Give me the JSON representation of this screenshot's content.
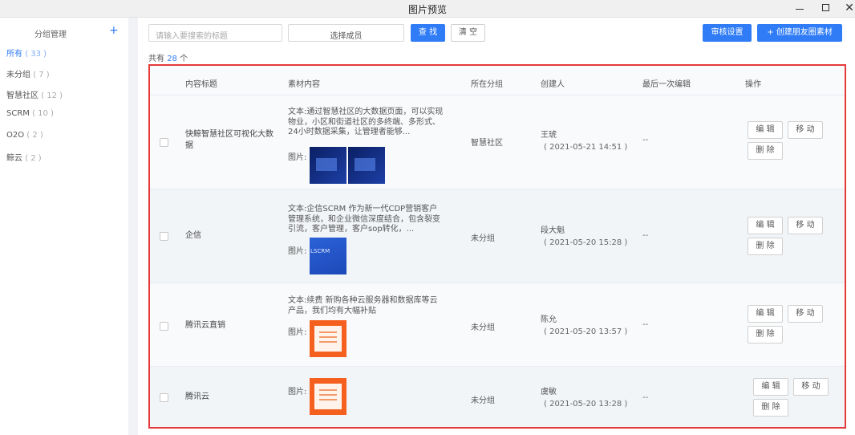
{
  "window": {
    "title": "图片预览"
  },
  "sidebar": {
    "header": "分组管理",
    "add_icon": "+",
    "items": [
      {
        "label": "所有",
        "count": "( 33 )",
        "active": true
      },
      {
        "label": "未分组",
        "count": "( 7 )"
      },
      {
        "label": "智慧社区",
        "count": "( 12 )"
      },
      {
        "label": "SCRM",
        "count": "( 10 )"
      },
      {
        "label": "O2O",
        "count": "( 2 )"
      },
      {
        "label": "鲸云",
        "count": "( 2 )"
      }
    ]
  },
  "toolbar": {
    "search_placeholder": "请输入要搜索的标题",
    "member_select": "选择成员",
    "search_button": "查 找",
    "clear_button": "清 空",
    "review_button": "审核设置",
    "create_button": "+ 创建朋友圈素材"
  },
  "summary": {
    "prefix": "共有",
    "count": "28",
    "suffix": "个"
  },
  "table": {
    "headers": [
      "内容标题",
      "素材内容",
      "所在分组",
      "创建人",
      "最后一次编辑",
      "操作"
    ],
    "text_label": "文本:",
    "image_label": "图片:",
    "actions": {
      "edit": "编 辑",
      "move": "移 动",
      "delete": "删 除"
    },
    "rows": [
      {
        "title": "快鲸智慧社区可视化大数据",
        "text": "通过智慧社区的大数据页面，可以实现物业，小区和街道社区的多终端、多形式、24小时数据采集，让管理者能够...",
        "group": "智慧社区",
        "creator": "王琥",
        "time": "( 2021-05-21 14:51 )",
        "last_edit": "--"
      },
      {
        "title": "企信",
        "text": "企信SCRM 作为新一代CDP营销客户管理系统，和企业微信深度结合，包含裂变引流，客户管理，客户sop转化，...",
        "thumb_text": "LSCRM",
        "group": "未分组",
        "creator": "段大魁",
        "time": "( 2021-05-20 15:28 )",
        "last_edit": "--"
      },
      {
        "title": "腾讯云直销",
        "text": "续费 新购各种云服务器和数据库等云产品，我们均有大幅补贴",
        "group": "未分组",
        "creator": "陈允",
        "time": "( 2021-05-20 13:57 )",
        "last_edit": "--"
      },
      {
        "title": "腾讯云",
        "group": "未分组",
        "creator": "虞敏",
        "time": "( 2021-05-20 13:28 )",
        "last_edit": "--"
      }
    ]
  }
}
